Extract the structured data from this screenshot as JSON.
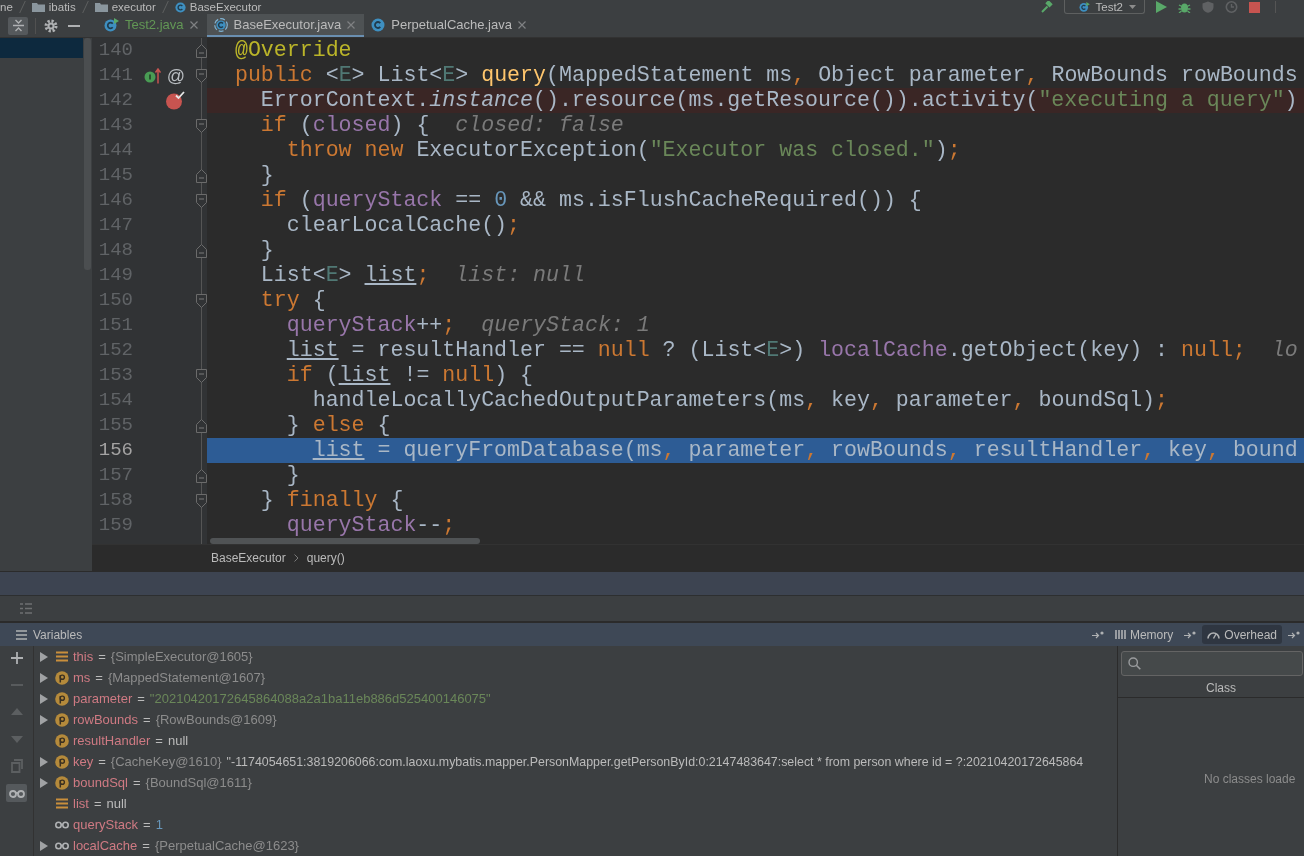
{
  "navigation_bar": {
    "path": [
      {
        "label": "ne",
        "kind": "segment"
      },
      {
        "label": "ibatis",
        "kind": "folder"
      },
      {
        "label": "executor",
        "kind": "folder"
      },
      {
        "label": "BaseExecutor",
        "kind": "class"
      }
    ],
    "toolbar": [
      {
        "kind": "build",
        "disabled": false
      },
      {
        "kind": "run_configuration",
        "label": "Test2",
        "disabled": false
      },
      {
        "kind": "run",
        "disabled": false
      },
      {
        "kind": "debug",
        "disabled": false
      },
      {
        "kind": "coverage",
        "disabled": true
      },
      {
        "kind": "profile",
        "disabled": true
      },
      {
        "kind": "stop",
        "disabled": false
      }
    ]
  },
  "project_toolbar": [
    {
      "kind": "collapse",
      "on": true
    },
    {
      "kind": "settings",
      "on": false
    },
    {
      "kind": "hide",
      "on": false
    }
  ],
  "tabs": [
    {
      "label": "Test2.java",
      "kind": "runnable_class",
      "color": "#629755",
      "selected": false
    },
    {
      "label": "BaseExecutor.java",
      "kind": "abstract_class",
      "color": "#bbbbbb",
      "selected": true
    },
    {
      "label": "PerpetualCache.java",
      "kind": "class",
      "color": "#bbbbbb",
      "selected": false
    }
  ],
  "editor": {
    "lines": [
      {
        "number": "140",
        "tokens": [
          {
            "text": "  @Override",
            "kind": "annotation"
          }
        ],
        "fold_start": false,
        "fold_end": true,
        "breakpoint": false,
        "current": false
      },
      {
        "number": "141",
        "tokens": [
          {
            "text": "  public",
            "kind": "keyword"
          },
          {
            "text": " <",
            "kind": "plain"
          },
          {
            "text": "E",
            "kind": "type_param"
          },
          {
            "text": "> List<",
            "kind": "plain"
          },
          {
            "text": "E",
            "kind": "type_param"
          },
          {
            "text": "> ",
            "kind": "plain"
          },
          {
            "text": "query",
            "kind": "method"
          },
          {
            "text": "(MappedStatement ms",
            "kind": "plain"
          },
          {
            "text": ",",
            "kind": "keyword"
          },
          {
            "text": " Object parameter",
            "kind": "plain"
          },
          {
            "text": ",",
            "kind": "keyword"
          },
          {
            "text": " RowBounds rowBounds",
            "kind": "plain"
          }
        ],
        "marks": [
          {
            "kind": "overrides"
          },
          {
            "kind": "symbol",
            "text": "@"
          }
        ],
        "fold_start": true,
        "fold_end": false,
        "breakpoint": false,
        "current": false
      },
      {
        "number": "142",
        "tokens": [
          {
            "text": "    ErrorContext.",
            "kind": "plain"
          },
          {
            "text": "instance",
            "kind": "static"
          },
          {
            "text": "().resource(ms.getResource()).activity(",
            "kind": "plain"
          },
          {
            "text": "\"executing a query\"",
            "kind": "string"
          },
          {
            "text": ")",
            "kind": "plain"
          }
        ],
        "fold_start": false,
        "fold_end": false,
        "breakpoint": true,
        "current": false
      },
      {
        "number": "143",
        "tokens": [
          {
            "text": "    if",
            "kind": "keyword"
          },
          {
            "text": " (",
            "kind": "plain"
          },
          {
            "text": "closed",
            "kind": "field"
          },
          {
            "text": ") {",
            "kind": "plain"
          }
        ],
        "inline_value": "closed: false",
        "fold_start": true,
        "fold_end": false,
        "breakpoint": false,
        "current": false
      },
      {
        "number": "144",
        "tokens": [
          {
            "text": "      throw new",
            "kind": "keyword"
          },
          {
            "text": " ExecutorException(",
            "kind": "plain"
          },
          {
            "text": "\"Executor was closed.\"",
            "kind": "string"
          },
          {
            "text": ")",
            "kind": "plain"
          },
          {
            "text": ";",
            "kind": "keyword"
          }
        ],
        "fold_start": false,
        "fold_end": false,
        "breakpoint": false,
        "current": false
      },
      {
        "number": "145",
        "tokens": [
          {
            "text": "    }",
            "kind": "plain"
          }
        ],
        "fold_start": false,
        "fold_end": true,
        "breakpoint": false,
        "current": false
      },
      {
        "number": "146",
        "tokens": [
          {
            "text": "    if",
            "kind": "keyword"
          },
          {
            "text": " (",
            "kind": "plain"
          },
          {
            "text": "queryStack",
            "kind": "field"
          },
          {
            "text": " == ",
            "kind": "plain"
          },
          {
            "text": "0",
            "kind": "number"
          },
          {
            "text": " && ms.isFlushCacheRequired()) {",
            "kind": "plain"
          }
        ],
        "fold_start": true,
        "fold_end": false,
        "breakpoint": false,
        "current": false
      },
      {
        "number": "147",
        "tokens": [
          {
            "text": "      clearLocalCache()",
            "kind": "plain"
          },
          {
            "text": ";",
            "kind": "keyword"
          }
        ],
        "fold_start": false,
        "fold_end": false,
        "breakpoint": false,
        "current": false
      },
      {
        "number": "148",
        "tokens": [
          {
            "text": "    }",
            "kind": "plain"
          }
        ],
        "fold_start": false,
        "fold_end": true,
        "breakpoint": false,
        "current": false
      },
      {
        "number": "149",
        "tokens": [
          {
            "text": "    List<",
            "kind": "plain"
          },
          {
            "text": "E",
            "kind": "type_param"
          },
          {
            "text": "> ",
            "kind": "plain"
          },
          {
            "text": "list",
            "kind": "reassigned"
          },
          {
            "text": ";",
            "kind": "keyword"
          }
        ],
        "inline_value": "list: null",
        "fold_start": false,
        "fold_end": false,
        "breakpoint": false,
        "current": false
      },
      {
        "number": "150",
        "tokens": [
          {
            "text": "    try",
            "kind": "keyword"
          },
          {
            "text": " {",
            "kind": "plain"
          }
        ],
        "fold_start": true,
        "fold_end": false,
        "breakpoint": false,
        "current": false
      },
      {
        "number": "151",
        "tokens": [
          {
            "text": "      queryStack",
            "kind": "field"
          },
          {
            "text": "++",
            "kind": "plain"
          },
          {
            "text": ";",
            "kind": "keyword"
          }
        ],
        "inline_value": "queryStack: 1",
        "fold_start": false,
        "fold_end": false,
        "breakpoint": false,
        "current": false
      },
      {
        "number": "152",
        "tokens": [
          {
            "text": "      list",
            "kind": "reassigned"
          },
          {
            "text": " = resultHandler == ",
            "kind": "plain"
          },
          {
            "text": "null",
            "kind": "keyword"
          },
          {
            "text": " ? (List<",
            "kind": "plain"
          },
          {
            "text": "E",
            "kind": "type_param"
          },
          {
            "text": ">) ",
            "kind": "plain"
          },
          {
            "text": "localCache",
            "kind": "field"
          },
          {
            "text": ".getObject(key) : ",
            "kind": "plain"
          },
          {
            "text": "null;",
            "kind": "keyword"
          }
        ],
        "inline_value": "lo",
        "fold_start": false,
        "fold_end": false,
        "breakpoint": false,
        "current": false
      },
      {
        "number": "153",
        "tokens": [
          {
            "text": "      if",
            "kind": "keyword"
          },
          {
            "text": " (",
            "kind": "plain"
          },
          {
            "text": "list",
            "kind": "reassigned"
          },
          {
            "text": " != ",
            "kind": "plain"
          },
          {
            "text": "null",
            "kind": "keyword"
          },
          {
            "text": ") {",
            "kind": "plain"
          }
        ],
        "fold_start": true,
        "fold_end": false,
        "breakpoint": false,
        "current": false
      },
      {
        "number": "154",
        "tokens": [
          {
            "text": "        handleLocallyCachedOutputParameters(ms",
            "kind": "plain"
          },
          {
            "text": ",",
            "kind": "keyword"
          },
          {
            "text": " key",
            "kind": "plain"
          },
          {
            "text": ",",
            "kind": "keyword"
          },
          {
            "text": " parameter",
            "kind": "plain"
          },
          {
            "text": ",",
            "kind": "keyword"
          },
          {
            "text": " boundSql)",
            "kind": "plain"
          },
          {
            "text": ";",
            "kind": "keyword"
          }
        ],
        "fold_start": false,
        "fold_end": false,
        "breakpoint": false,
        "current": false
      },
      {
        "number": "155",
        "tokens": [
          {
            "text": "      } ",
            "kind": "plain"
          },
          {
            "text": "else",
            "kind": "keyword"
          },
          {
            "text": " {",
            "kind": "plain"
          }
        ],
        "fold_start": false,
        "fold_end": true,
        "breakpoint": false,
        "current": false
      },
      {
        "number": "156",
        "tokens": [
          {
            "text": "        list",
            "kind": "reassigned"
          },
          {
            "text": " = queryFromDatabase(ms",
            "kind": "plain"
          },
          {
            "text": ",",
            "kind": "keyword"
          },
          {
            "text": " parameter",
            "kind": "plain"
          },
          {
            "text": ",",
            "kind": "keyword"
          },
          {
            "text": " rowBounds",
            "kind": "plain"
          },
          {
            "text": ",",
            "kind": "keyword"
          },
          {
            "text": " resultHandler",
            "kind": "plain"
          },
          {
            "text": ",",
            "kind": "keyword"
          },
          {
            "text": " key",
            "kind": "plain"
          },
          {
            "text": ",",
            "kind": "keyword"
          },
          {
            "text": " bound",
            "kind": "plain"
          }
        ],
        "fold_start": false,
        "fold_end": false,
        "breakpoint": false,
        "current": true
      },
      {
        "number": "157",
        "tokens": [
          {
            "text": "      }",
            "kind": "plain"
          }
        ],
        "fold_start": false,
        "fold_end": true,
        "breakpoint": false,
        "current": false
      },
      {
        "number": "158",
        "tokens": [
          {
            "text": "    } ",
            "kind": "plain"
          },
          {
            "text": "finally",
            "kind": "keyword"
          },
          {
            "text": " {",
            "kind": "plain"
          }
        ],
        "fold_start": true,
        "fold_end": false,
        "breakpoint": false,
        "current": false
      },
      {
        "number": "159",
        "tokens": [
          {
            "text": "      queryStack",
            "kind": "field"
          },
          {
            "text": "--",
            "kind": "plain"
          },
          {
            "text": ";",
            "kind": "keyword"
          }
        ],
        "fold_start": false,
        "fold_end": false,
        "breakpoint": false,
        "current": false
      }
    ]
  },
  "breadcrumbs": [
    "BaseExecutor",
    "query()"
  ],
  "debugger": {
    "title": "Variables",
    "layout_tabs": [
      {
        "label": "Memory",
        "kind": "memory",
        "selected": false
      },
      {
        "label": "Overhead",
        "kind": "overhead",
        "selected": true
      }
    ],
    "watch_toolbar": [
      {
        "kind": "add",
        "disabled": false,
        "on": false
      },
      {
        "kind": "remove",
        "disabled": true,
        "on": false
      },
      {
        "kind": "up",
        "disabled": true,
        "on": false
      },
      {
        "kind": "down",
        "disabled": true,
        "on": false
      },
      {
        "kind": "copy",
        "disabled": true,
        "on": false
      },
      {
        "kind": "watches",
        "disabled": false,
        "on": true
      }
    ],
    "variables": [
      {
        "kind": "variable",
        "name": "this",
        "separator": "=",
        "value": {
          "text": "{SimpleExecutor@1605}",
          "kind": "object"
        },
        "has_children": true
      },
      {
        "kind": "parameter",
        "name": "ms",
        "separator": "=",
        "value": {
          "text": "{MappedStatement@1607}",
          "kind": "object"
        },
        "has_children": true
      },
      {
        "kind": "parameter",
        "name": "parameter",
        "separator": "=",
        "value": {
          "text": "\"20210420172645864088a2a1ba11eb886d525400146075\"",
          "kind": "string"
        },
        "has_children": true
      },
      {
        "kind": "parameter",
        "name": "rowBounds",
        "separator": "=",
        "value": {
          "text": "{RowBounds@1609}",
          "kind": "object"
        },
        "has_children": true
      },
      {
        "kind": "parameter",
        "name": "resultHandler",
        "separator": "=",
        "value": {
          "text": "null",
          "kind": "null"
        },
        "has_children": false
      },
      {
        "kind": "parameter",
        "name": "key",
        "separator": "=",
        "value": {
          "text": "{CacheKey@1610}",
          "kind": "object"
        },
        "description": "\"-1174054651:3819206066:com.laoxu.mybatis.mapper.PersonMapper.getPersonById:0:2147483647:select * from person where id = ?:20210420172645864",
        "has_children": true
      },
      {
        "kind": "parameter",
        "name": "boundSql",
        "separator": "=",
        "value": {
          "text": "{BoundSql@1611}",
          "kind": "object"
        },
        "has_children": true
      },
      {
        "kind": "variable",
        "name": "list",
        "separator": "=",
        "value": {
          "text": "null",
          "kind": "null"
        },
        "has_children": false
      },
      {
        "kind": "watch",
        "name": "queryStack",
        "separator": "=",
        "value": {
          "text": "1",
          "kind": "primitive"
        },
        "has_children": false
      },
      {
        "kind": "watch",
        "name": "localCache",
        "separator": "=",
        "value": {
          "text": "{PerpetualCache@1623}",
          "kind": "object"
        },
        "has_children": true
      }
    ],
    "memory": {
      "column": "Class",
      "empty_text": "No classes loade"
    }
  }
}
